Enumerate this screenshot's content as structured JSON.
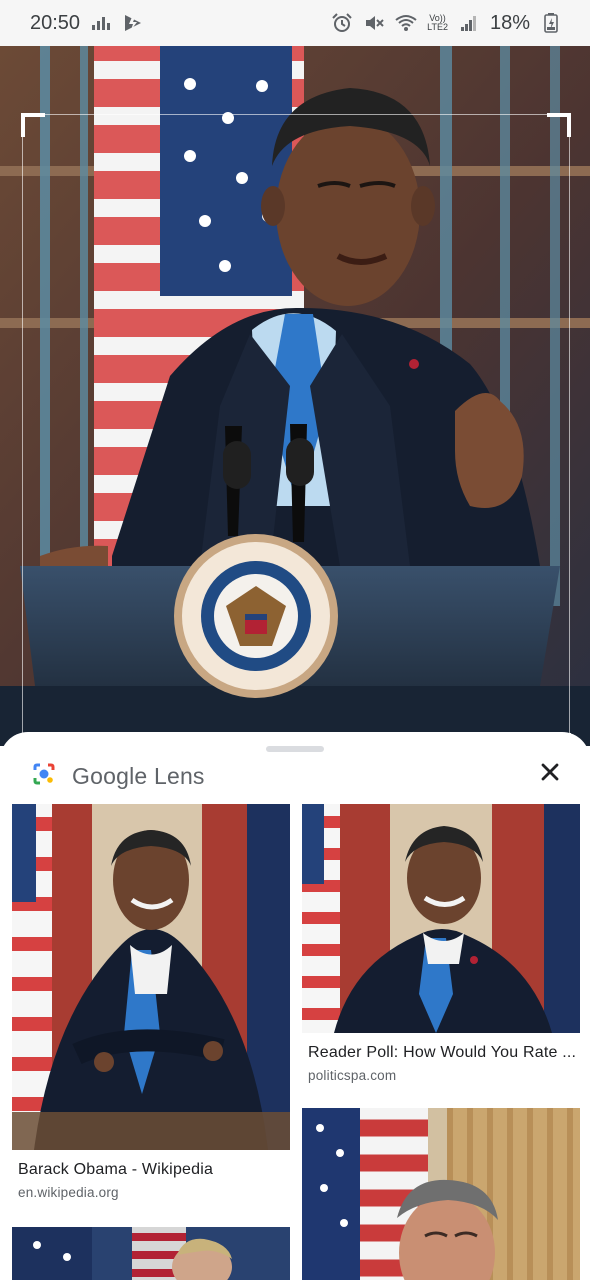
{
  "status_bar": {
    "time": "20:50",
    "lte_top": "Vo))",
    "lte_bottom": "LTE2",
    "battery": "18%"
  },
  "sheet": {
    "app_name": "Google Lens"
  },
  "results": [
    {
      "title": "Barack Obama - Wikipedia",
      "source": "en.wikipedia.org"
    },
    {
      "title": "Reader Poll: How Would You Rate ...",
      "source": "politicspa.com"
    }
  ],
  "colors": {
    "lens_blue": "#4285f4",
    "lens_red": "#ea4335",
    "lens_yellow": "#fbbc05",
    "lens_green": "#34a853",
    "suit": "#151e2f",
    "tie": "#2f78c9"
  },
  "icons": {
    "equalizer": "equalizer-icon",
    "flash": "flash-icon",
    "alarm": "alarm-icon",
    "mute": "mute-icon",
    "wifi": "wifi-icon",
    "signal": "signal-icon",
    "battery": "battery-icon",
    "close": "close-icon",
    "lens": "google-lens-icon"
  }
}
